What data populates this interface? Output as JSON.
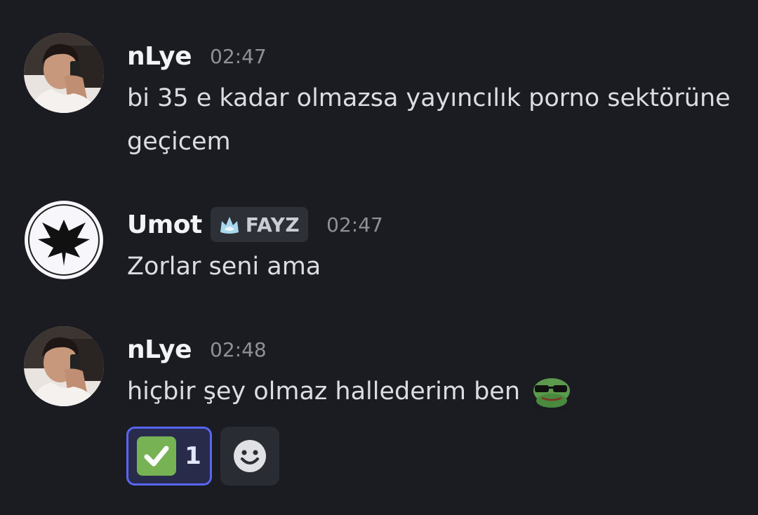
{
  "messages": [
    {
      "username": "nLye",
      "timestamp": "02:47",
      "avatar": "profile-photo-man-phone",
      "text": "bi 35 e kadar olmazsa yayıncılık porno sektörüne geçicem"
    },
    {
      "username": "Umot",
      "timestamp": "02:47",
      "avatar": "phoenix-logo",
      "tag": {
        "label": "FAYZ",
        "icon": "wolf-icon"
      },
      "text": "Zorlar seni ama"
    },
    {
      "username": "nLye",
      "timestamp": "02:48",
      "avatar": "profile-photo-man-phone",
      "text": "hiçbir şey olmaz hallederim ben",
      "emoji": "pepe-sunglasses-emoji"
    }
  ],
  "reactions": [
    {
      "emoji": "white-check-mark",
      "count": "1",
      "active": true
    },
    {
      "emoji": "add-reaction-smiley",
      "count": "",
      "active": false
    }
  ],
  "colors": {
    "background": "#1b1c22",
    "username": "#f2f3f5",
    "text": "#dbdee1",
    "timestamp": "#8e9297",
    "reaction_active_border": "#5865f2",
    "reaction_active_bg": "#292b4b",
    "check_green": "#77b255"
  }
}
